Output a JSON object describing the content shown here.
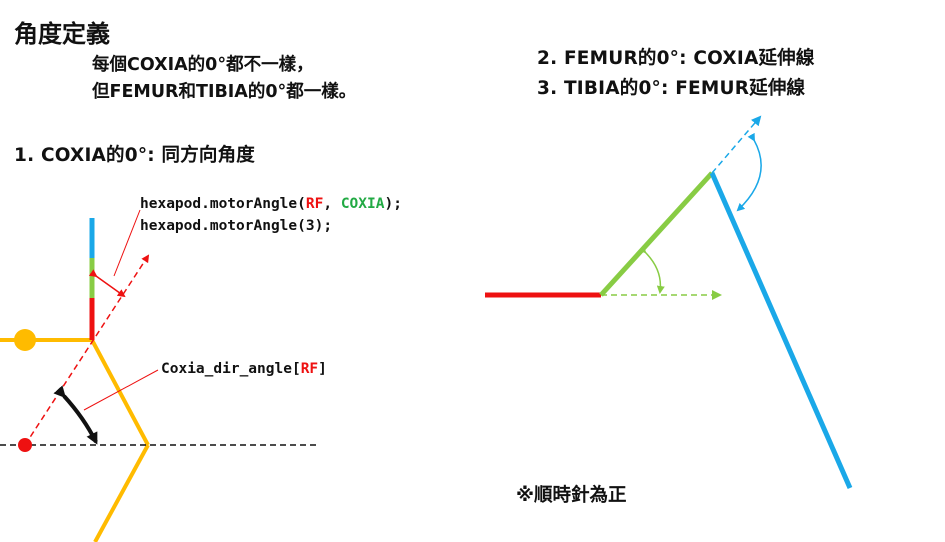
{
  "title": "角度定義",
  "subtitle": {
    "line1": "每個COXIA的0°都不一樣，",
    "line2": "但FEMUR和TIBIA的0°都一樣。"
  },
  "headings": {
    "item1": "1. COXIA的0°: 同方向角度",
    "item2": "2. FEMUR的0°: COXIA延伸線",
    "item3": "3. TIBIA的0°: FEMUR延伸線"
  },
  "code": {
    "line1": {
      "prefix": "hexapod.motorAngle(",
      "arg1": "RF",
      "sep": ", ",
      "arg2": "COXIA",
      "suffix": ");"
    },
    "line2": "hexapod.motorAngle(3);",
    "label": {
      "prefix": "Coxia_dir_angle[",
      "arg": "RF",
      "suffix": "]"
    }
  },
  "note": "※順時針為正",
  "colors": {
    "coxia": "#ee1111",
    "femur": "#88cc44",
    "tibia": "#1aa8e8",
    "body": "#ffbb00",
    "arrow_curved": "#111111"
  }
}
